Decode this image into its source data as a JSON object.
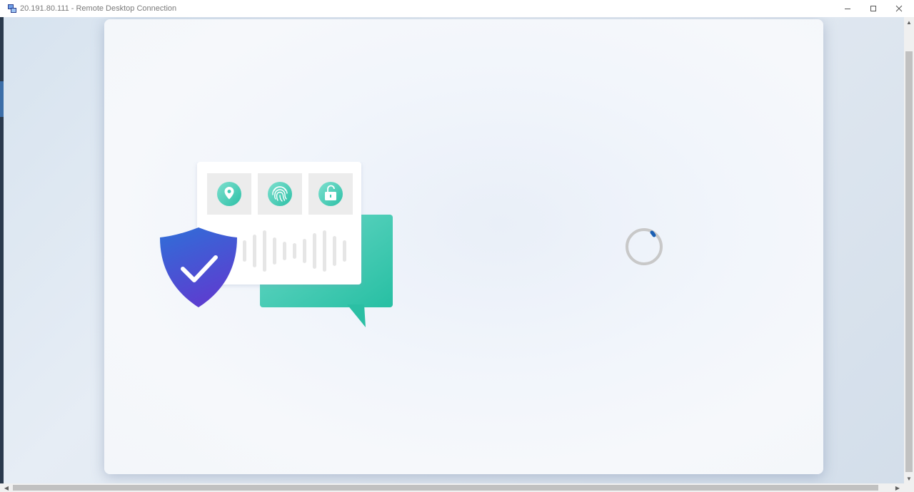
{
  "window": {
    "title": "20.191.80.111 - Remote Desktop Connection",
    "controls": {
      "minimize_icon": "minimize-icon",
      "maximize_icon": "maximize-icon",
      "close_icon": "close-icon"
    }
  },
  "remote_screen": {
    "illustration": {
      "icons": [
        "location-pin-icon",
        "fingerprint-icon",
        "unlock-icon",
        "shield-check-icon",
        "chat-bubble-icon"
      ]
    },
    "loading_indicator": "spinner"
  },
  "colors": {
    "shield_top": "#2f6fd8",
    "shield_bottom": "#5b3fd0",
    "teal": "#3fcbb5",
    "spinner_track": "#c8c8c8",
    "spinner_accent": "#1a5fb4"
  }
}
